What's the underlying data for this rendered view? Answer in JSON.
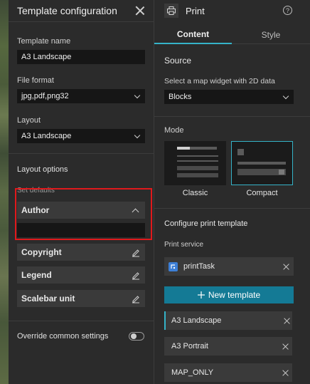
{
  "template_panel": {
    "title": "Template configuration",
    "template_name_label": "Template name",
    "template_name_value": "A3 Landscape",
    "file_format_label": "File format",
    "file_format_value": "jpg,pdf,png32",
    "layout_label": "Layout",
    "layout_value": "A3 Landscape",
    "layout_options_title": "Layout options",
    "set_defaults_label": "Set defaults",
    "author_label": "Author",
    "author_value": "",
    "copyright_label": "Copyright",
    "legend_label": "Legend",
    "scalebar_label": "Scalebar unit",
    "override_label": "Override common settings",
    "override_enabled": false
  },
  "print_panel": {
    "title": "Print",
    "tabs": [
      {
        "label": "Content",
        "active": true
      },
      {
        "label": "Style",
        "active": false
      }
    ],
    "source_title": "Source",
    "source_hint": "Select a map widget with 2D data",
    "source_value": "Blocks",
    "mode_title": "Mode",
    "modes": [
      {
        "label": "Classic",
        "selected": false
      },
      {
        "label": "Compact",
        "selected": true
      }
    ],
    "configure_title": "Configure print template",
    "print_service_label": "Print service",
    "print_service_value": "printTask",
    "new_template_label": "New template",
    "templates": [
      {
        "label": "A3 Landscape",
        "selected": true
      },
      {
        "label": "A3 Portrait",
        "selected": false
      },
      {
        "label": "MAP_ONLY",
        "selected": false
      }
    ]
  },
  "colors": {
    "accent": "#35b3c8",
    "primary_button": "#147a95",
    "highlight_border": "#e0191c"
  }
}
